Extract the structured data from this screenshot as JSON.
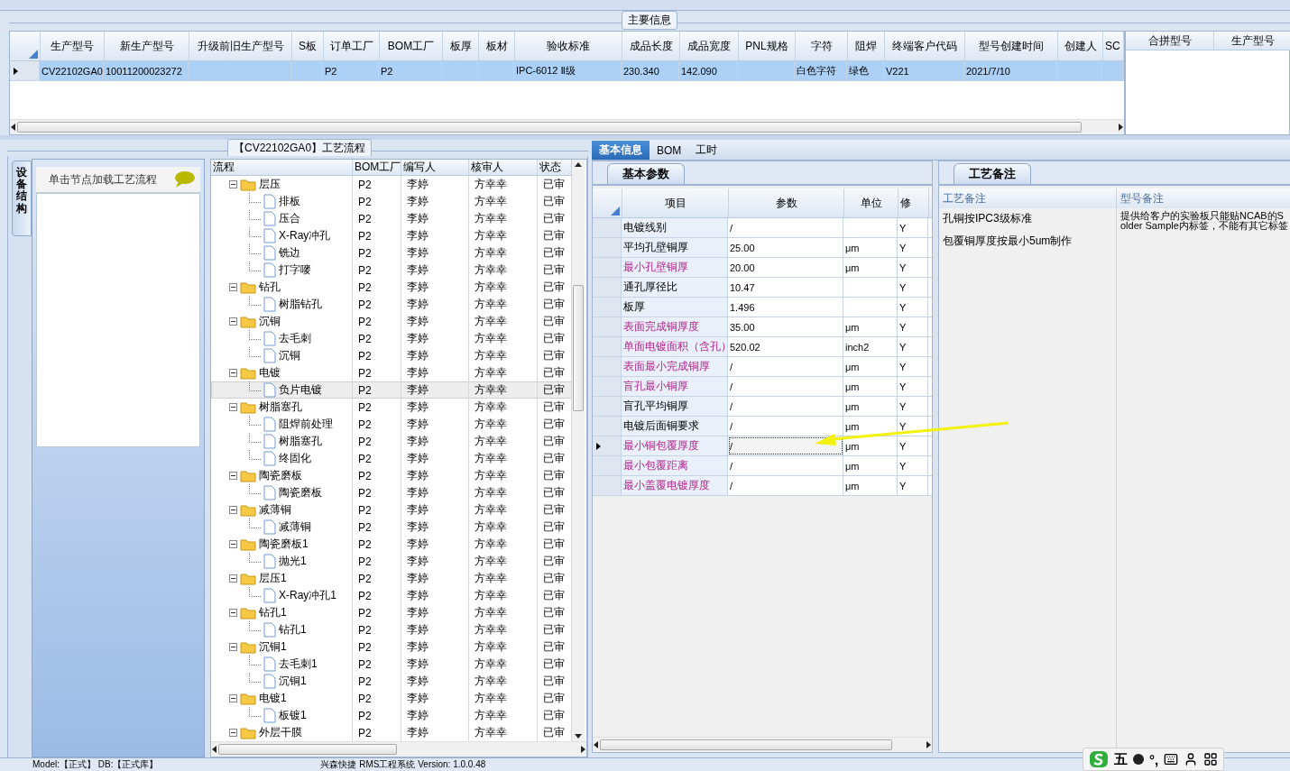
{
  "main_info": {
    "title": "主要信息",
    "columns": [
      "生产型号",
      "新生产型号",
      "升级前旧生产型号",
      "S板",
      "订单工厂",
      "BOM工厂",
      "板厚",
      "板材",
      "验收标准",
      "成品长度",
      "成品宽度",
      "PNL规格",
      "字符",
      "阻焊",
      "终端客户代码",
      "型号创建时间",
      "创建人",
      "SC"
    ],
    "rows": [
      {
        "selected": true,
        "cells": [
          "CV22102GA0",
          "10011200023272",
          null,
          null,
          "P2",
          "P2",
          null,
          null,
          "IPC-6012 Ⅱ级",
          "230.340",
          "142.090",
          null,
          "白色字符",
          "绿色",
          "V221",
          "2021/7/10",
          null,
          null
        ]
      }
    ],
    "side_columns": [
      "合拼型号",
      "生产型号"
    ]
  },
  "process": {
    "title": "【CV22102GA0】工艺流程",
    "side_tab": "设备结构",
    "hint": "单击节点加载工艺流程",
    "columns": [
      "流程",
      "BOM工厂",
      "编写人",
      "核审人",
      "状态"
    ],
    "tree": [
      {
        "kind": "folder",
        "name": "层压",
        "factory": "P2",
        "writer": "李婷",
        "reviewer": "方幸幸",
        "status": "已审",
        "expanded": true,
        "selected": false,
        "children": [
          {
            "kind": "step",
            "name": "排板",
            "factory": "P2",
            "writer": "李婷",
            "reviewer": "方幸幸",
            "status": "已审",
            "selected": false
          },
          {
            "kind": "step",
            "name": "压合",
            "factory": "P2",
            "writer": "李婷",
            "reviewer": "方幸幸",
            "status": "已审",
            "selected": false
          },
          {
            "kind": "step",
            "name": "X-Ray冲孔",
            "factory": "P2",
            "writer": "李婷",
            "reviewer": "方幸幸",
            "status": "已审",
            "selected": false
          },
          {
            "kind": "step",
            "name": "铣边",
            "factory": "P2",
            "writer": "李婷",
            "reviewer": "方幸幸",
            "status": "已审",
            "selected": false
          },
          {
            "kind": "step",
            "name": "打字嘜",
            "factory": "P2",
            "writer": "李婷",
            "reviewer": "方幸幸",
            "status": "已审",
            "selected": false
          }
        ]
      },
      {
        "kind": "folder",
        "name": "钻孔",
        "factory": "P2",
        "writer": "李婷",
        "reviewer": "方幸幸",
        "status": "已审",
        "expanded": true,
        "selected": false,
        "children": [
          {
            "kind": "step",
            "name": "树脂钻孔",
            "factory": "P2",
            "writer": "李婷",
            "reviewer": "方幸幸",
            "status": "已审",
            "selected": false
          }
        ]
      },
      {
        "kind": "folder",
        "name": "沉铜",
        "factory": "P2",
        "writer": "李婷",
        "reviewer": "方幸幸",
        "status": "已审",
        "expanded": true,
        "selected": false,
        "children": [
          {
            "kind": "step",
            "name": "去毛刺",
            "factory": "P2",
            "writer": "李婷",
            "reviewer": "方幸幸",
            "status": "已审",
            "selected": false
          },
          {
            "kind": "step",
            "name": "沉铜",
            "factory": "P2",
            "writer": "李婷",
            "reviewer": "方幸幸",
            "status": "已审",
            "selected": false
          }
        ]
      },
      {
        "kind": "folder",
        "name": "电镀",
        "factory": "P2",
        "writer": "李婷",
        "reviewer": "方幸幸",
        "status": "已审",
        "expanded": true,
        "selected": false,
        "children": [
          {
            "kind": "step",
            "name": "负片电镀",
            "factory": "P2",
            "writer": "李婷",
            "reviewer": "方幸幸",
            "status": "已审",
            "selected": true
          }
        ]
      },
      {
        "kind": "folder",
        "name": "树脂塞孔",
        "factory": "P2",
        "writer": "李婷",
        "reviewer": "方幸幸",
        "status": "已审",
        "expanded": true,
        "selected": false,
        "children": [
          {
            "kind": "step",
            "name": "阻焊前处理",
            "factory": "P2",
            "writer": "李婷",
            "reviewer": "方幸幸",
            "status": "已审",
            "selected": false
          },
          {
            "kind": "step",
            "name": "树脂塞孔",
            "factory": "P2",
            "writer": "李婷",
            "reviewer": "方幸幸",
            "status": "已审",
            "selected": false
          },
          {
            "kind": "step",
            "name": "终固化",
            "factory": "P2",
            "writer": "李婷",
            "reviewer": "方幸幸",
            "status": "已审",
            "selected": false
          }
        ]
      },
      {
        "kind": "folder",
        "name": "陶瓷磨板",
        "factory": "P2",
        "writer": "李婷",
        "reviewer": "方幸幸",
        "status": "已审",
        "expanded": true,
        "selected": false,
        "children": [
          {
            "kind": "step",
            "name": "陶瓷磨板",
            "factory": "P2",
            "writer": "李婷",
            "reviewer": "方幸幸",
            "status": "已审",
            "selected": false
          }
        ]
      },
      {
        "kind": "folder",
        "name": "减薄铜",
        "factory": "P2",
        "writer": "李婷",
        "reviewer": "方幸幸",
        "status": "已审",
        "expanded": true,
        "selected": false,
        "children": [
          {
            "kind": "step",
            "name": "减薄铜",
            "factory": "P2",
            "writer": "李婷",
            "reviewer": "方幸幸",
            "status": "已审",
            "selected": false
          }
        ]
      },
      {
        "kind": "folder",
        "name": "陶瓷磨板1",
        "factory": "P2",
        "writer": "李婷",
        "reviewer": "方幸幸",
        "status": "已审",
        "expanded": true,
        "selected": false,
        "children": [
          {
            "kind": "step",
            "name": "抛光1",
            "factory": "P2",
            "writer": "李婷",
            "reviewer": "方幸幸",
            "status": "已审",
            "selected": false
          }
        ]
      },
      {
        "kind": "folder",
        "name": "层压1",
        "factory": "P2",
        "writer": "李婷",
        "reviewer": "方幸幸",
        "status": "已审",
        "expanded": true,
        "selected": false,
        "children": [
          {
            "kind": "step",
            "name": "X-Ray冲孔1",
            "factory": "P2",
            "writer": "李婷",
            "reviewer": "方幸幸",
            "status": "已审",
            "selected": false
          }
        ]
      },
      {
        "kind": "folder",
        "name": "钻孔1",
        "factory": "P2",
        "writer": "李婷",
        "reviewer": "方幸幸",
        "status": "已审",
        "expanded": true,
        "selected": false,
        "children": [
          {
            "kind": "step",
            "name": "钻孔1",
            "factory": "P2",
            "writer": "李婷",
            "reviewer": "方幸幸",
            "status": "已审",
            "selected": false
          }
        ]
      },
      {
        "kind": "folder",
        "name": "沉铜1",
        "factory": "P2",
        "writer": "李婷",
        "reviewer": "方幸幸",
        "status": "已审",
        "expanded": true,
        "selected": false,
        "children": [
          {
            "kind": "step",
            "name": "去毛刺1",
            "factory": "P2",
            "writer": "李婷",
            "reviewer": "方幸幸",
            "status": "已审",
            "selected": false
          },
          {
            "kind": "step",
            "name": "沉铜1",
            "factory": "P2",
            "writer": "李婷",
            "reviewer": "方幸幸",
            "status": "已审",
            "selected": false
          }
        ]
      },
      {
        "kind": "folder",
        "name": "电镀1",
        "factory": "P2",
        "writer": "李婷",
        "reviewer": "方幸幸",
        "status": "已审",
        "expanded": true,
        "selected": false,
        "children": [
          {
            "kind": "step",
            "name": "板镀1",
            "factory": "P2",
            "writer": "李婷",
            "reviewer": "方幸幸",
            "status": "已审",
            "selected": false
          }
        ]
      },
      {
        "kind": "folder",
        "name": "外层干膜",
        "factory": "P2",
        "writer": "李婷",
        "reviewer": "方幸幸",
        "status": "已审",
        "expanded": true,
        "selected": false
      }
    ]
  },
  "detail": {
    "tabs": [
      {
        "label": "基本信息",
        "selected": true
      },
      {
        "label": "BOM",
        "selected": false
      },
      {
        "label": "工时",
        "selected": false
      }
    ],
    "params": {
      "tab": "基本参数",
      "columns": [
        "项目",
        "参数",
        "单位",
        "修"
      ],
      "rows": [
        {
          "item": "电镀线别",
          "value": "/",
          "unit": null,
          "modified": "Y",
          "highlighted": false,
          "current": false
        },
        {
          "item": "平均孔壁铜厚",
          "value": "25.00",
          "unit": "μm",
          "modified": "Y",
          "highlighted": false,
          "current": false
        },
        {
          "item": "最小孔壁铜厚",
          "value": "20.00",
          "unit": "μm",
          "modified": "Y",
          "highlighted": true,
          "current": false
        },
        {
          "item": "通孔厚径比",
          "value": "10.47",
          "unit": null,
          "modified": "Y",
          "highlighted": false,
          "current": false
        },
        {
          "item": "板厚",
          "value": "1.496",
          "unit": null,
          "modified": "Y",
          "highlighted": false,
          "current": false
        },
        {
          "item": "表面完成铜厚度",
          "value": "35.00",
          "unit": "μm",
          "modified": "Y",
          "highlighted": true,
          "current": false
        },
        {
          "item": "单面电镀面积（含孔）",
          "value": "520.02",
          "unit": "inch2",
          "modified": "Y",
          "highlighted": true,
          "current": false
        },
        {
          "item": "表面最小完成铜厚",
          "value": "/",
          "unit": "μm",
          "modified": "Y",
          "highlighted": true,
          "current": false
        },
        {
          "item": "盲孔最小铜厚",
          "value": "/",
          "unit": "μm",
          "modified": "Y",
          "highlighted": true,
          "current": false
        },
        {
          "item": "盲孔平均铜厚",
          "value": "/",
          "unit": "μm",
          "modified": "Y",
          "highlighted": false,
          "current": false
        },
        {
          "item": "电镀后面铜要求",
          "value": "/",
          "unit": "μm",
          "modified": "Y",
          "highlighted": false,
          "current": false
        },
        {
          "item": "最小铜包覆厚度",
          "value": "/",
          "unit": "μm",
          "modified": "Y",
          "highlighted": true,
          "current": true
        },
        {
          "item": "最小包覆距离",
          "value": "/",
          "unit": "μm",
          "modified": "Y",
          "highlighted": true,
          "current": false
        },
        {
          "item": "最小盖覆电镀厚度",
          "value": "/",
          "unit": "μm",
          "modified": "Y",
          "highlighted": true,
          "current": false
        }
      ]
    },
    "notes": {
      "tab": "工艺备注",
      "columns": [
        "工艺备注",
        "型号备注"
      ],
      "process_notes": [
        "孔铜按IPC3级标准",
        "包覆铜厚度按最小5um制作"
      ],
      "model_note": "提供给客户的实验板只能贴NCAB的Solder Sample内标签，不能有其它标签"
    }
  },
  "status_bar": {
    "left": "Model:【正式】 DB:【正式库】",
    "center": "兴森快捷 RMS工程系统 Version: 1.0.0.48"
  },
  "ime": {
    "mode": "五",
    "punctuation": "°,"
  }
}
